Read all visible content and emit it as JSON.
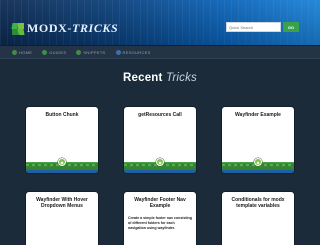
{
  "header": {
    "logo_text_main": "MODX",
    "logo_text_sep": "-",
    "logo_text_accent": "TRICKS",
    "search_placeholder": "Quick Search",
    "search_button": "GO"
  },
  "nav": {
    "items": [
      {
        "label": "HOME",
        "icon": "home-icon"
      },
      {
        "label": "GUIDES",
        "icon": "book-icon"
      },
      {
        "label": "SNIPPETS",
        "icon": "code-icon"
      },
      {
        "label": "RESOURCES",
        "icon": "link-icon"
      }
    ]
  },
  "section": {
    "title_main": "Recent",
    "title_accent": "Tricks"
  },
  "cards": [
    {
      "title": "Button Chunk",
      "desc": ""
    },
    {
      "title": "getResources Call",
      "desc": ""
    },
    {
      "title": "Wayfinder Example",
      "desc": ""
    },
    {
      "title": "Wayfinder With Hover Dropdown Menus",
      "desc": ""
    },
    {
      "title": "Wayfinder Footer Nav Example",
      "desc": "Create a simple footer nav consisting of different folders for each navigation using wayfinder."
    },
    {
      "title": "Conditionals for modx template variables",
      "desc": ""
    }
  ],
  "colors": {
    "accent_green": "#3aa14b",
    "background": "#1b2b3a",
    "header_blue": "#0a62b8"
  }
}
